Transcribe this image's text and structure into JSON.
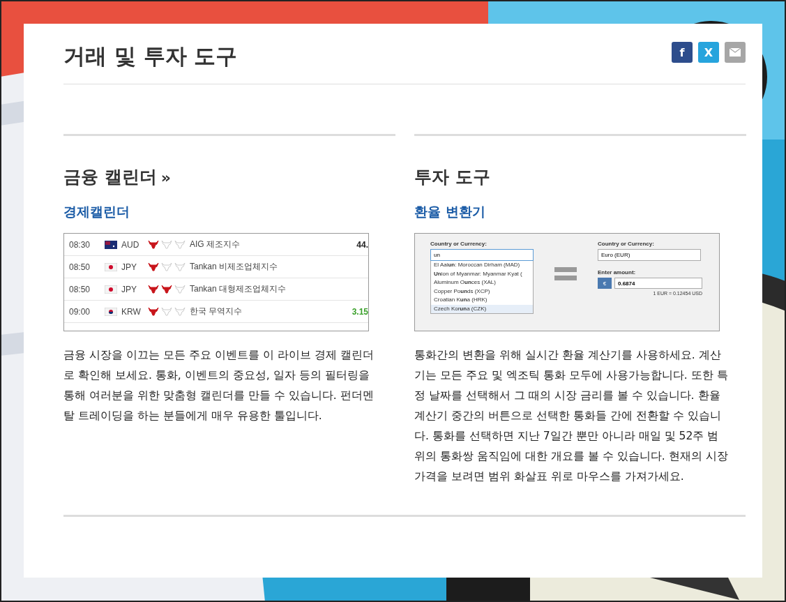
{
  "header": {
    "title": "거래 및 투자 도구",
    "share_buttons": [
      {
        "kind": "facebook",
        "glyph": "f"
      },
      {
        "kind": "x",
        "glyph": "X"
      },
      {
        "kind": "email"
      }
    ]
  },
  "sections": [
    {
      "heading": "금융 캘린더",
      "heading_suffix": "»",
      "link": "경제캘린더",
      "preview": {
        "kind": "calendar",
        "rows": [
          {
            "time": "08:30",
            "flag": {
              "kind": "au"
            },
            "currency": "AUD",
            "stars": 1,
            "event": "AIG 제조지수",
            "actual": {
              "text": "44.",
              "color": "#222222"
            }
          },
          {
            "time": "08:50",
            "flag": {
              "kind": "jp"
            },
            "currency": "JPY",
            "stars": 1,
            "event": "Tankan 비제조업체지수"
          },
          {
            "time": "08:50",
            "flag": {
              "kind": "jp"
            },
            "currency": "JPY",
            "stars": 2,
            "event": "Tankan 대형제조업체지수"
          },
          {
            "time": "09:00",
            "flag": {
              "kind": "kr"
            },
            "currency": "KRW",
            "stars": 1,
            "event": "한국 무역지수",
            "actual": {
              "text": "3.15",
              "color": "#3aa02a"
            }
          }
        ]
      },
      "description": "금융 시장을 이끄는 모든 주요 이벤트를 이 라이브 경제 캘린더로 확인해 보세요. 통화, 이벤트의 중요성, 일자 등의 필터링을 통해 여러분을 위한 맞춤형 캘린더를 만들 수 있습니다. 펀더멘탈 트레이딩을 하는 분들에게 매우 유용한 툴입니다."
    },
    {
      "heading": "투자 도구",
      "link": "환율 변환기",
      "preview": {
        "kind": "converter",
        "from_label": "Country or Currency:",
        "from_value": "un",
        "options": [
          {
            "text": "El Aai**un**: Moroccan Dirham (MAD)",
            "selected": false
          },
          {
            "text": "**Un**ion of Myanmar: Myanmar Kyat (",
            "selected": false
          },
          {
            "text": "Aluminum O**un**ces (XAL)",
            "selected": false
          },
          {
            "text": "Copper Po**un**ds (XCP)",
            "selected": false
          },
          {
            "text": "Croatian K**un**a (HRK)",
            "selected": false
          },
          {
            "text": "Czech Kor**un**a (CZK)",
            "selected": true
          }
        ],
        "to_label": "Country or Currency:",
        "to_value": "Euro (EUR)",
        "amount_label": "Enter amount:",
        "currency_symbol": "€",
        "amount": "0.6874",
        "rate": "1 EUR = 0.12454 USD"
      },
      "description": "통화간의 변환을 위해 실시간 환율 계산기를 사용하세요. 계산기는 모든 주요 및 엑조틱 통화 모두에 사용가능합니다. 또한 특정 날짜를 선택해서 그 때의 시장 금리를 볼 수 있습니다. 환율 계산기 중간의 버튼으로 선택한 통화들 간에 전환할 수 있습니다. 통화를 선택하면 지난 7일간 뿐만 아니라 매일 및 52주 범위의 통화쌍 움직임에 대한 개요를 볼 수 있습니다. 현재의 시장 가격을 보려면 범위 화살표 위로 마우스를 가져가세요."
    }
  ]
}
